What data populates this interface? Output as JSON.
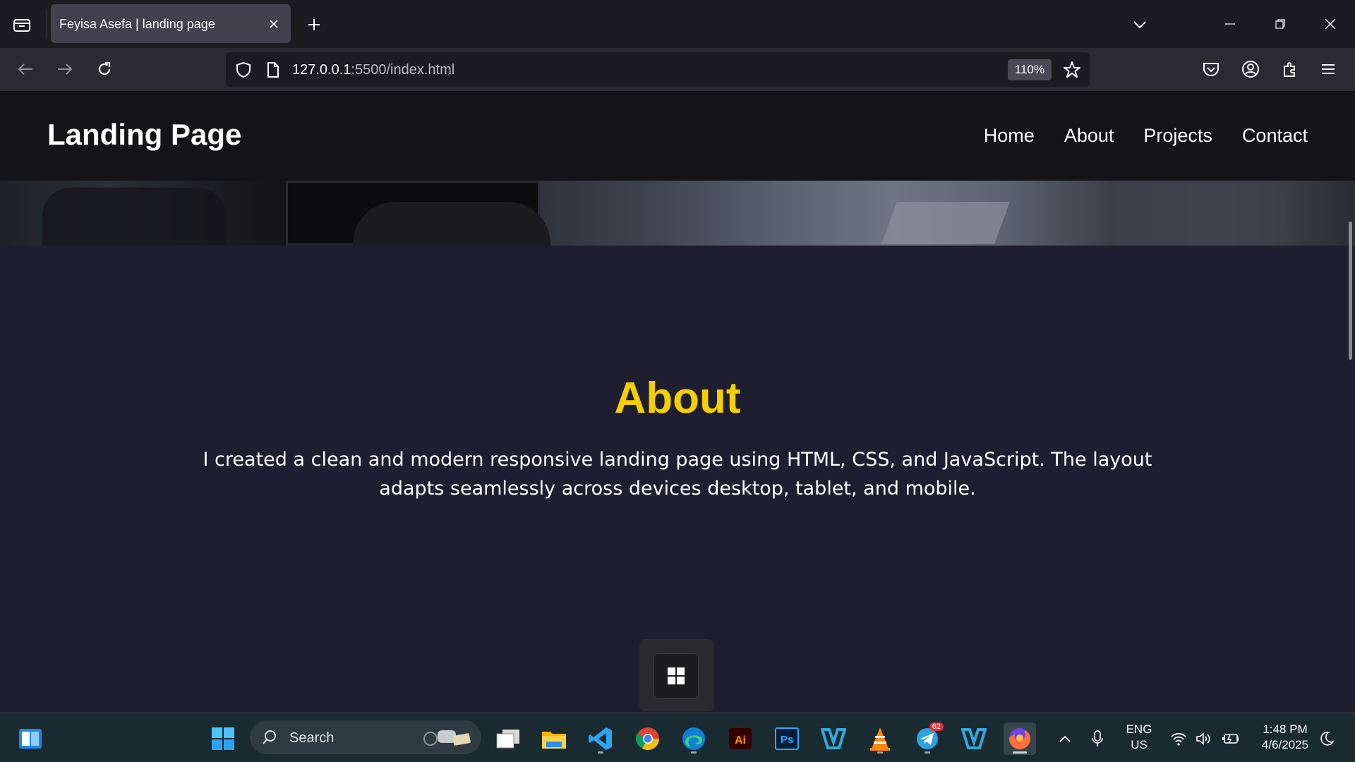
{
  "browser": {
    "tab_title": "Feyisa Asefa | landing page",
    "url_host": "127.0.0.1",
    "url_path": ":5500/index.html",
    "zoom": "110%"
  },
  "site": {
    "logo": "Landing Page",
    "nav": [
      "Home",
      "About",
      "Projects",
      "Contact"
    ],
    "about_title": "About",
    "about_text": "I created a clean and modern responsive landing page using HTML, CSS, and JavaScript. The layout adapts seamlessly across devices desktop, tablet, and mobile."
  },
  "taskbar": {
    "search_label": "Search",
    "telegram_badge": "62",
    "language_line1": "ENG",
    "language_line2": "US",
    "time": "1:48 PM",
    "date": "4/6/2025"
  },
  "colors": {
    "accent_yellow": "#f5cf00",
    "page_bg": "#1f1e30",
    "header_bg": "#141418"
  },
  "icons": [
    "tab-list-icon",
    "close-icon",
    "plus-icon",
    "chevron-down-icon",
    "minimize-icon",
    "restore-icon",
    "back-arrow-icon",
    "forward-arrow-icon",
    "reload-icon",
    "shield-icon",
    "page-icon",
    "star-icon",
    "pocket-icon",
    "account-icon",
    "extensions-icon",
    "menu-icon",
    "windows-icon",
    "search-icon"
  ]
}
